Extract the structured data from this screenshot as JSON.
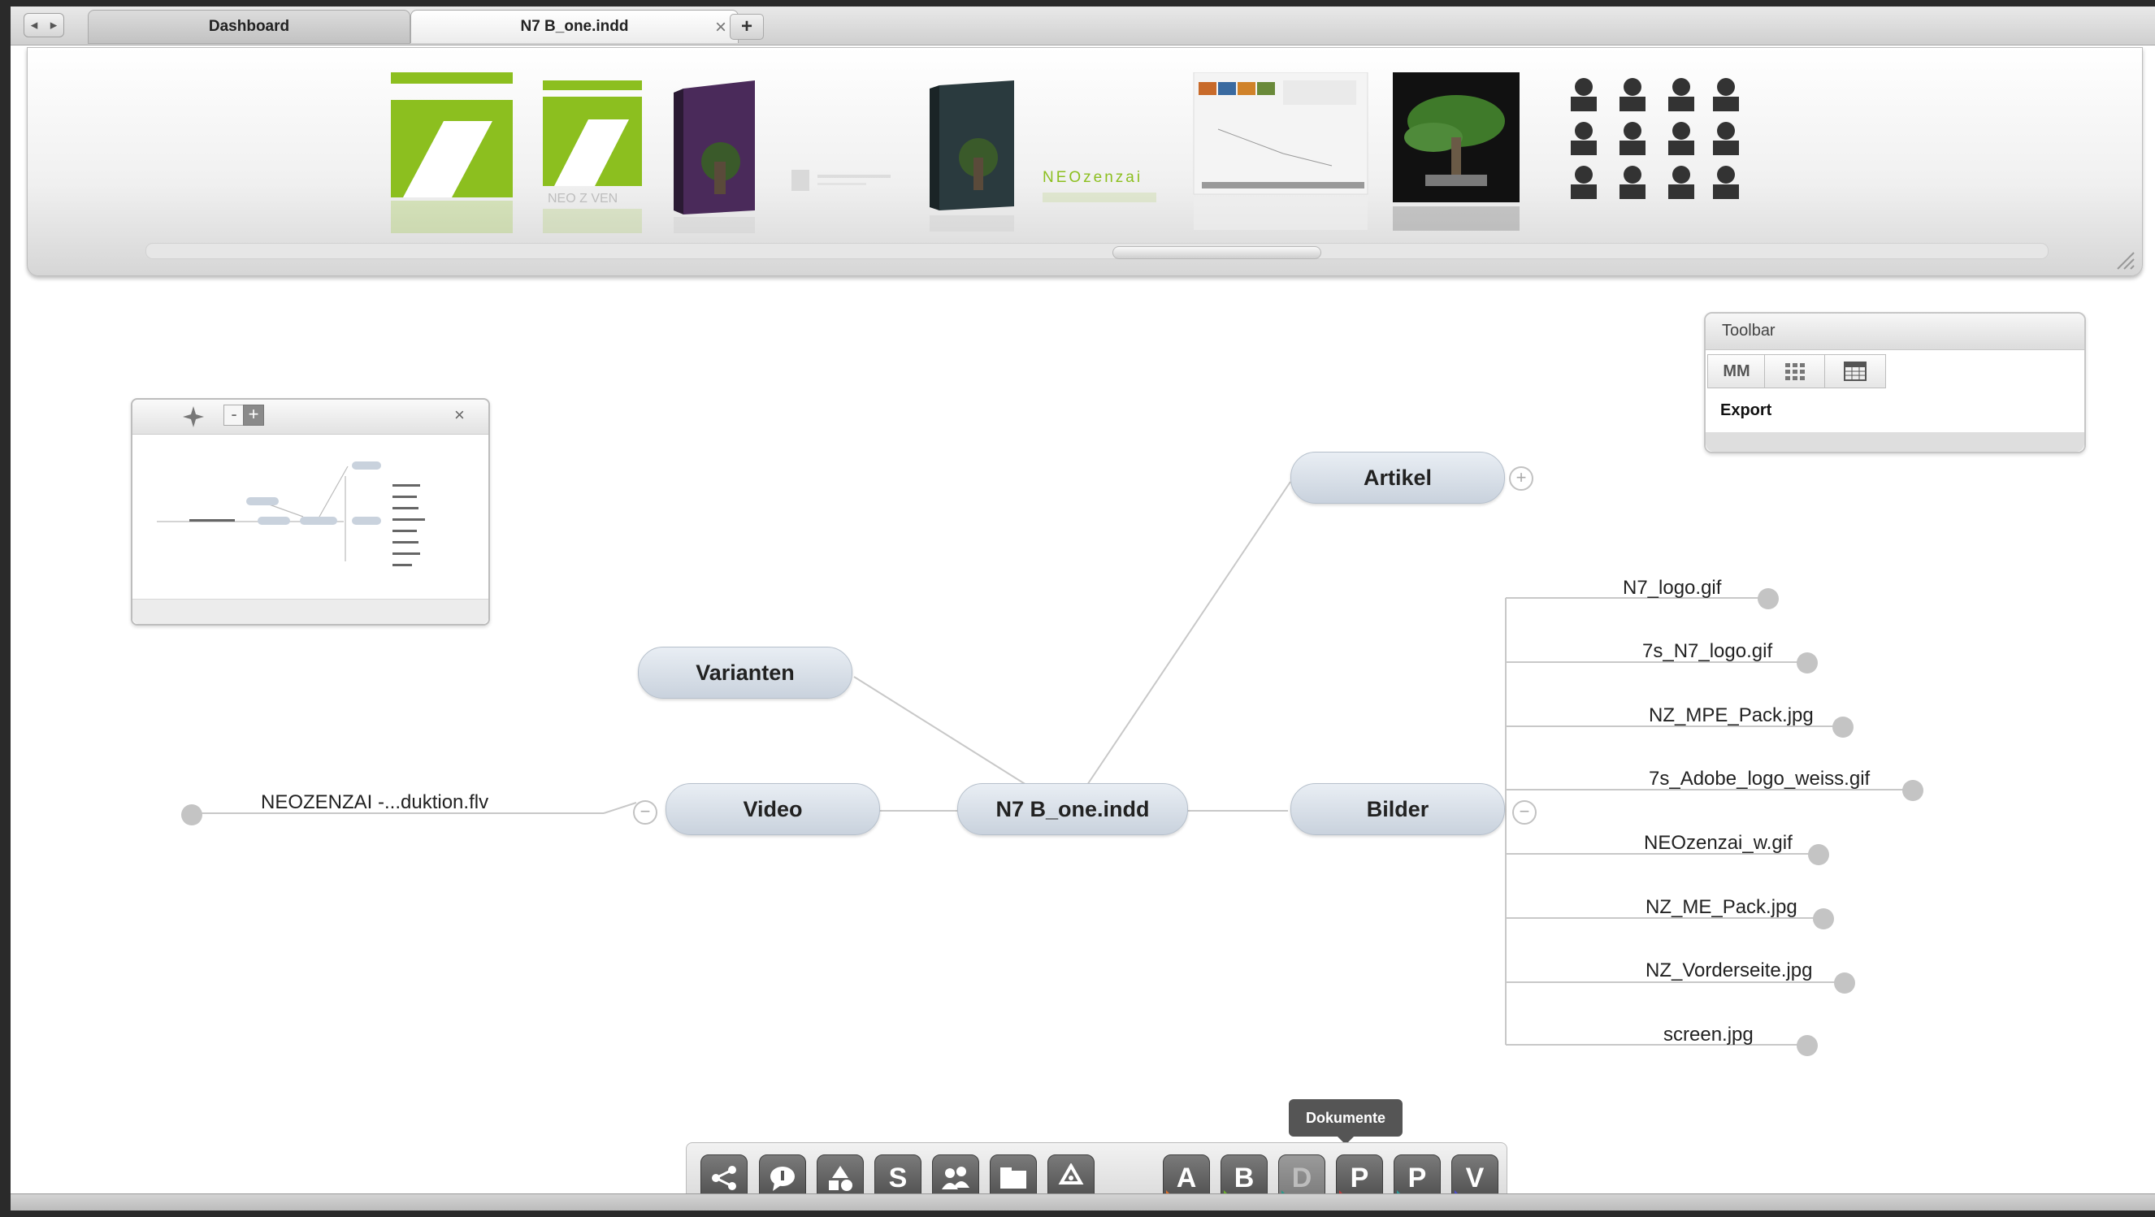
{
  "tabs": {
    "dashboard": "Dashboard",
    "document": "N7 B_one.indd",
    "close_glyph": "×",
    "add_glyph": "+"
  },
  "nav": {
    "back": "◂",
    "forward": "▸"
  },
  "thumbnails": {
    "logo_text": "NEO Z VEN",
    "brand_text": "NEOzenzai"
  },
  "mindmap": {
    "center": "N7 B_one.indd",
    "artikel": "Artikel",
    "varianten": "Varianten",
    "video": "Video",
    "bilder": "Bilder",
    "video_file": "NEOZENZAI -...duktion.flv",
    "images": [
      "N7_logo.gif",
      "7s_N7_logo.gif",
      "NZ_MPE_Pack.jpg",
      "7s_Adobe_logo_weiss.gif",
      "NEOzenzai_w.gif",
      "NZ_ME_Pack.jpg",
      "NZ_Vorderseite.jpg",
      "screen.jpg"
    ],
    "collapse_glyph": "−",
    "expand_glyph": "+"
  },
  "overview": {
    "minus": "-",
    "plus": "+",
    "close": "×"
  },
  "toolbar": {
    "title": "Toolbar",
    "mm_label": "MM",
    "export_label": "Export"
  },
  "dock": {
    "tooltip": "Dokumente",
    "letters": [
      "A",
      "B",
      "D",
      "P",
      "P",
      "V"
    ]
  },
  "colors": {
    "accent_green": "#8cbf1f",
    "node_fill": "#d6dde6",
    "dock_button": "#5e5e5e"
  }
}
